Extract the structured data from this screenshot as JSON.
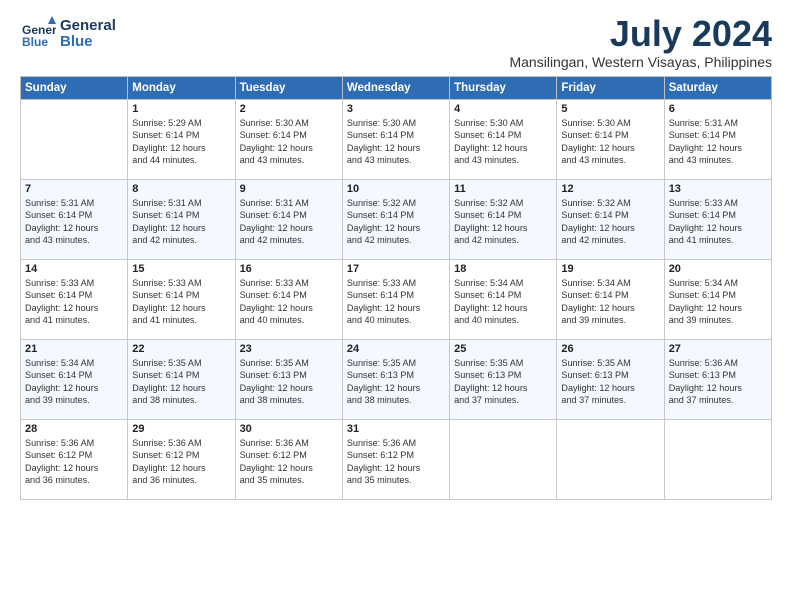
{
  "header": {
    "logo_line1": "General",
    "logo_line2": "Blue",
    "month": "July 2024",
    "location": "Mansilingan, Western Visayas, Philippines"
  },
  "days_of_week": [
    "Sunday",
    "Monday",
    "Tuesday",
    "Wednesday",
    "Thursday",
    "Friday",
    "Saturday"
  ],
  "weeks": [
    [
      {
        "day": "",
        "text": ""
      },
      {
        "day": "1",
        "text": "Sunrise: 5:29 AM\nSunset: 6:14 PM\nDaylight: 12 hours\nand 44 minutes."
      },
      {
        "day": "2",
        "text": "Sunrise: 5:30 AM\nSunset: 6:14 PM\nDaylight: 12 hours\nand 43 minutes."
      },
      {
        "day": "3",
        "text": "Sunrise: 5:30 AM\nSunset: 6:14 PM\nDaylight: 12 hours\nand 43 minutes."
      },
      {
        "day": "4",
        "text": "Sunrise: 5:30 AM\nSunset: 6:14 PM\nDaylight: 12 hours\nand 43 minutes."
      },
      {
        "day": "5",
        "text": "Sunrise: 5:30 AM\nSunset: 6:14 PM\nDaylight: 12 hours\nand 43 minutes."
      },
      {
        "day": "6",
        "text": "Sunrise: 5:31 AM\nSunset: 6:14 PM\nDaylight: 12 hours\nand 43 minutes."
      }
    ],
    [
      {
        "day": "7",
        "text": "Sunrise: 5:31 AM\nSunset: 6:14 PM\nDaylight: 12 hours\nand 43 minutes."
      },
      {
        "day": "8",
        "text": "Sunrise: 5:31 AM\nSunset: 6:14 PM\nDaylight: 12 hours\nand 42 minutes."
      },
      {
        "day": "9",
        "text": "Sunrise: 5:31 AM\nSunset: 6:14 PM\nDaylight: 12 hours\nand 42 minutes."
      },
      {
        "day": "10",
        "text": "Sunrise: 5:32 AM\nSunset: 6:14 PM\nDaylight: 12 hours\nand 42 minutes."
      },
      {
        "day": "11",
        "text": "Sunrise: 5:32 AM\nSunset: 6:14 PM\nDaylight: 12 hours\nand 42 minutes."
      },
      {
        "day": "12",
        "text": "Sunrise: 5:32 AM\nSunset: 6:14 PM\nDaylight: 12 hours\nand 42 minutes."
      },
      {
        "day": "13",
        "text": "Sunrise: 5:33 AM\nSunset: 6:14 PM\nDaylight: 12 hours\nand 41 minutes."
      }
    ],
    [
      {
        "day": "14",
        "text": "Sunrise: 5:33 AM\nSunset: 6:14 PM\nDaylight: 12 hours\nand 41 minutes."
      },
      {
        "day": "15",
        "text": "Sunrise: 5:33 AM\nSunset: 6:14 PM\nDaylight: 12 hours\nand 41 minutes."
      },
      {
        "day": "16",
        "text": "Sunrise: 5:33 AM\nSunset: 6:14 PM\nDaylight: 12 hours\nand 40 minutes."
      },
      {
        "day": "17",
        "text": "Sunrise: 5:33 AM\nSunset: 6:14 PM\nDaylight: 12 hours\nand 40 minutes."
      },
      {
        "day": "18",
        "text": "Sunrise: 5:34 AM\nSunset: 6:14 PM\nDaylight: 12 hours\nand 40 minutes."
      },
      {
        "day": "19",
        "text": "Sunrise: 5:34 AM\nSunset: 6:14 PM\nDaylight: 12 hours\nand 39 minutes."
      },
      {
        "day": "20",
        "text": "Sunrise: 5:34 AM\nSunset: 6:14 PM\nDaylight: 12 hours\nand 39 minutes."
      }
    ],
    [
      {
        "day": "21",
        "text": "Sunrise: 5:34 AM\nSunset: 6:14 PM\nDaylight: 12 hours\nand 39 minutes."
      },
      {
        "day": "22",
        "text": "Sunrise: 5:35 AM\nSunset: 6:14 PM\nDaylight: 12 hours\nand 38 minutes."
      },
      {
        "day": "23",
        "text": "Sunrise: 5:35 AM\nSunset: 6:13 PM\nDaylight: 12 hours\nand 38 minutes."
      },
      {
        "day": "24",
        "text": "Sunrise: 5:35 AM\nSunset: 6:13 PM\nDaylight: 12 hours\nand 38 minutes."
      },
      {
        "day": "25",
        "text": "Sunrise: 5:35 AM\nSunset: 6:13 PM\nDaylight: 12 hours\nand 37 minutes."
      },
      {
        "day": "26",
        "text": "Sunrise: 5:35 AM\nSunset: 6:13 PM\nDaylight: 12 hours\nand 37 minutes."
      },
      {
        "day": "27",
        "text": "Sunrise: 5:36 AM\nSunset: 6:13 PM\nDaylight: 12 hours\nand 37 minutes."
      }
    ],
    [
      {
        "day": "28",
        "text": "Sunrise: 5:36 AM\nSunset: 6:12 PM\nDaylight: 12 hours\nand 36 minutes."
      },
      {
        "day": "29",
        "text": "Sunrise: 5:36 AM\nSunset: 6:12 PM\nDaylight: 12 hours\nand 36 minutes."
      },
      {
        "day": "30",
        "text": "Sunrise: 5:36 AM\nSunset: 6:12 PM\nDaylight: 12 hours\nand 35 minutes."
      },
      {
        "day": "31",
        "text": "Sunrise: 5:36 AM\nSunset: 6:12 PM\nDaylight: 12 hours\nand 35 minutes."
      },
      {
        "day": "",
        "text": ""
      },
      {
        "day": "",
        "text": ""
      },
      {
        "day": "",
        "text": ""
      }
    ]
  ]
}
